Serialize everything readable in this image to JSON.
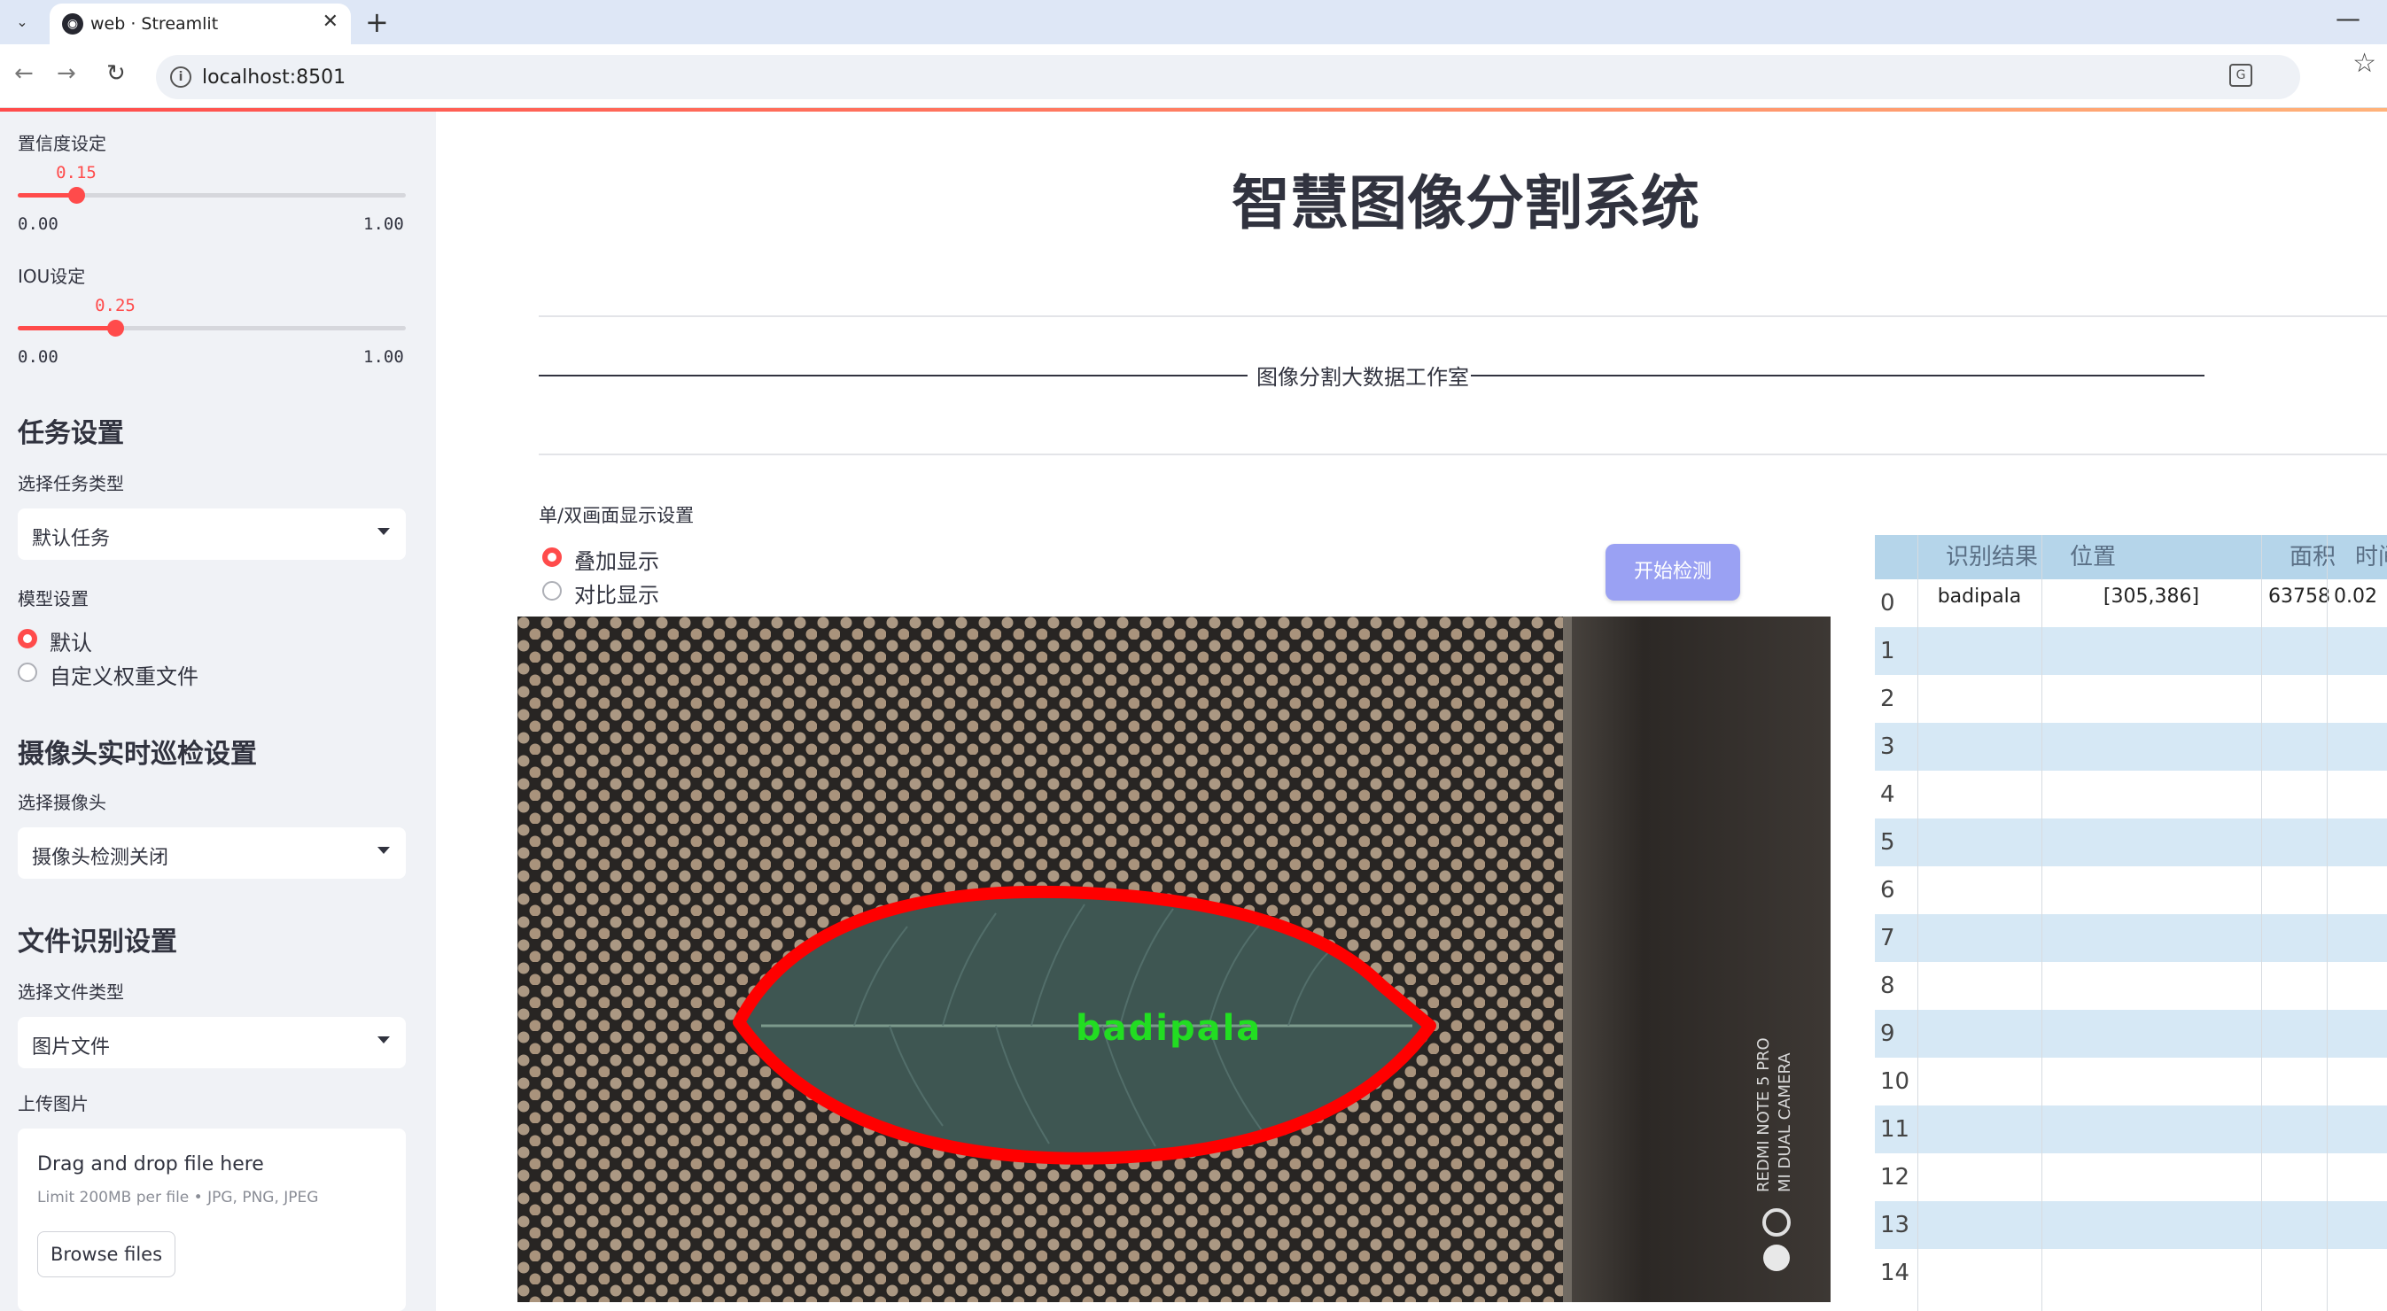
{
  "browser": {
    "tab_title": "web · Streamlit",
    "new_tab": "+",
    "url": "localhost:8501",
    "menu_glyph": "⌄",
    "close_glyph": "✕",
    "minimize_glyph": "—"
  },
  "sidebar": {
    "confidence": {
      "label": "置信度设定",
      "value": 0.15,
      "value_text": "0.15",
      "min": "0.00",
      "max": "1.00"
    },
    "iou": {
      "label": "IOU设定",
      "value": 0.25,
      "value_text": "0.25",
      "min": "0.00",
      "max": "1.00"
    },
    "task_header": "任务设置",
    "task_type_label": "选择任务类型",
    "task_type_value": "默认任务",
    "model_label": "模型设置",
    "model_options": [
      "默认",
      "自定义权重文件"
    ],
    "model_selected": "默认",
    "camera_header": "摄像头实时巡检设置",
    "camera_label": "选择摄像头",
    "camera_value": "摄像头检测关闭",
    "file_header": "文件识别设置",
    "file_type_label": "选择文件类型",
    "file_type_value": "图片文件",
    "upload_label": "上传图片",
    "upload_main": "Drag and drop file here",
    "upload_sub": "Limit 200MB per file • JPG, PNG, JPEG",
    "browse_label": "Browse files"
  },
  "main": {
    "title": "智慧图像分割系统",
    "subtitle": "图像分割大数据工作室",
    "display_label": "单/双画面显示设置",
    "display_options": [
      "叠加显示",
      "对比显示"
    ],
    "display_selected": "叠加显示",
    "start_button": "开始检测",
    "detection_label": "badipala",
    "photo_watermark_line1": "REDMI NOTE 5 PRO",
    "photo_watermark_line2": "MI DUAL CAMERA"
  },
  "table": {
    "headers": [
      "",
      "识别结果",
      "位置",
      "面积",
      "时间"
    ],
    "rows": [
      {
        "idx": "0",
        "result": "badipala",
        "position": "[305,386]",
        "area": "63758",
        "time": "0.02"
      },
      {
        "idx": "1"
      },
      {
        "idx": "2"
      },
      {
        "idx": "3"
      },
      {
        "idx": "4"
      },
      {
        "idx": "5"
      },
      {
        "idx": "6"
      },
      {
        "idx": "7"
      },
      {
        "idx": "8"
      },
      {
        "idx": "9"
      },
      {
        "idx": "10"
      },
      {
        "idx": "11"
      },
      {
        "idx": "12"
      },
      {
        "idx": "13"
      },
      {
        "idx": "14"
      }
    ]
  },
  "colors": {
    "accent": "#ff4b4b",
    "button": "#9aa1f3",
    "sidebar_bg": "#f0f2f6",
    "table_header": "#b5d5ea",
    "table_alt_row": "#d6e8f5",
    "detection_outline": "#ff0000",
    "detection_text": "#22dd22"
  },
  "icons": [
    "streamlit-favicon",
    "back-arrow-icon",
    "forward-arrow-icon",
    "reload-icon",
    "site-info-icon",
    "translate-icon",
    "bookmark-star-icon",
    "dropdown-chevron-icon"
  ]
}
